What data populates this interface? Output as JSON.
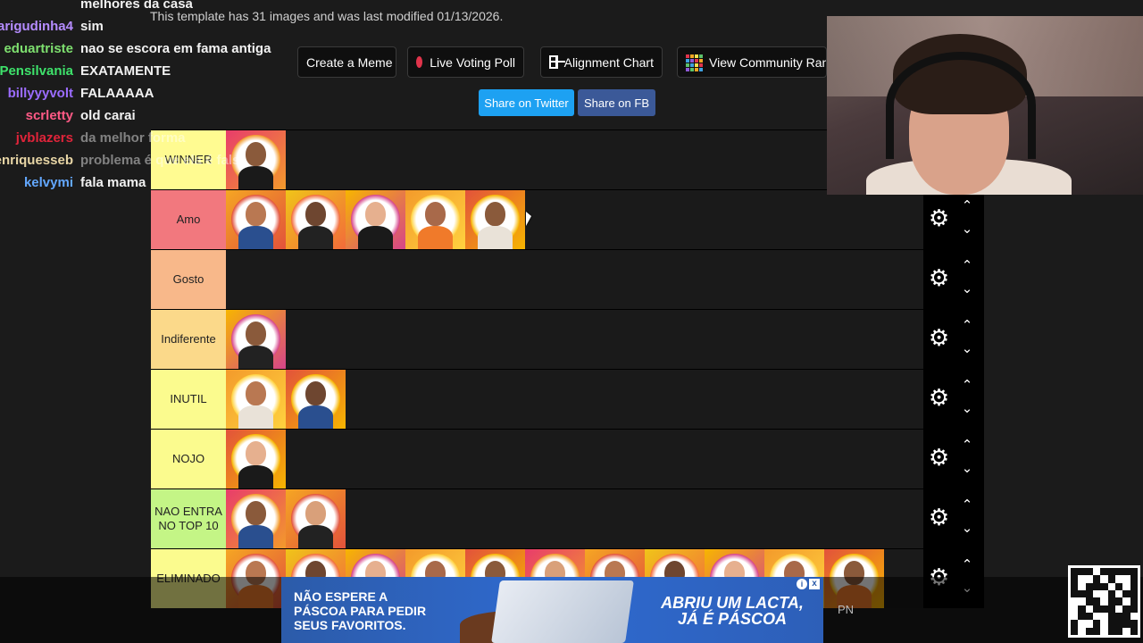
{
  "template_info": "This template has 31 images and was last modified 01/13/2026.",
  "toolbar": {
    "create_meme": "Create a Meme",
    "live_voting": "Live Voting Poll",
    "alignment_chart": "Alignment Chart",
    "community_rank": "View Community Rank"
  },
  "share": {
    "twitter": "Share on Twitter",
    "facebook": "Share on FB"
  },
  "chat": [
    {
      "user": "",
      "msg": "melhores da casa",
      "color": "#f2f2f2"
    },
    {
      "user": "arigudinha4",
      "msg": "sim",
      "color": "#b58cff"
    },
    {
      "user": "eduartriste",
      "msg": "nao se escora em fama antiga",
      "color": "#7ee06f"
    },
    {
      "user": "Pensilvania",
      "msg": "EXATAMENTE",
      "color": "#3ee26b"
    },
    {
      "user": "billyyyvolt",
      "msg": "FALAAAAA",
      "color": "#9b6cff"
    },
    {
      "user": "scrletty",
      "msg": "old carai",
      "color": "#ff5a86"
    },
    {
      "user": "jvblazers",
      "msg": "da melhor forma",
      "color": "#e0243a"
    },
    {
      "user": "enriquesseb",
      "msg": "problema é que ela é falsa",
      "color": "#e7d5a5"
    },
    {
      "user": "kelvymi",
      "msg": "fala mama",
      "color": "#63a8ff"
    }
  ],
  "tiers": [
    {
      "label": "WINNER",
      "color": "#fffb91",
      "items": 1
    },
    {
      "label": "Amo",
      "color": "#f2787e",
      "items": 5
    },
    {
      "label": "Gosto",
      "color": "#f8b88a",
      "items": 0
    },
    {
      "label": "Indiferente",
      "color": "#fbd98a",
      "items": 1
    },
    {
      "label": "INUTIL",
      "color": "#fbfb8e",
      "items": 2
    },
    {
      "label": "NOJO",
      "color": "#fbfb8e",
      "items": 1
    },
    {
      "label": "NAO ENTRA NO TOP 10",
      "color": "#c4f586",
      "items": 2
    },
    {
      "label": "ELIMINADO",
      "color": "#fbfb8e",
      "items": 11
    }
  ],
  "ad": {
    "left_text": "NÃO ESPERE A PÁSCOA PARA PEDIR SEUS FAVORITOS.",
    "right_text": "ABRIU UM LACTA, JÁ É PÁSCOA",
    "close": "x",
    "info": "i"
  },
  "pn_label": "PN",
  "icons": {
    "settings": "gear-icon",
    "up": "chevron-up-icon",
    "down": "chevron-down-icon"
  }
}
